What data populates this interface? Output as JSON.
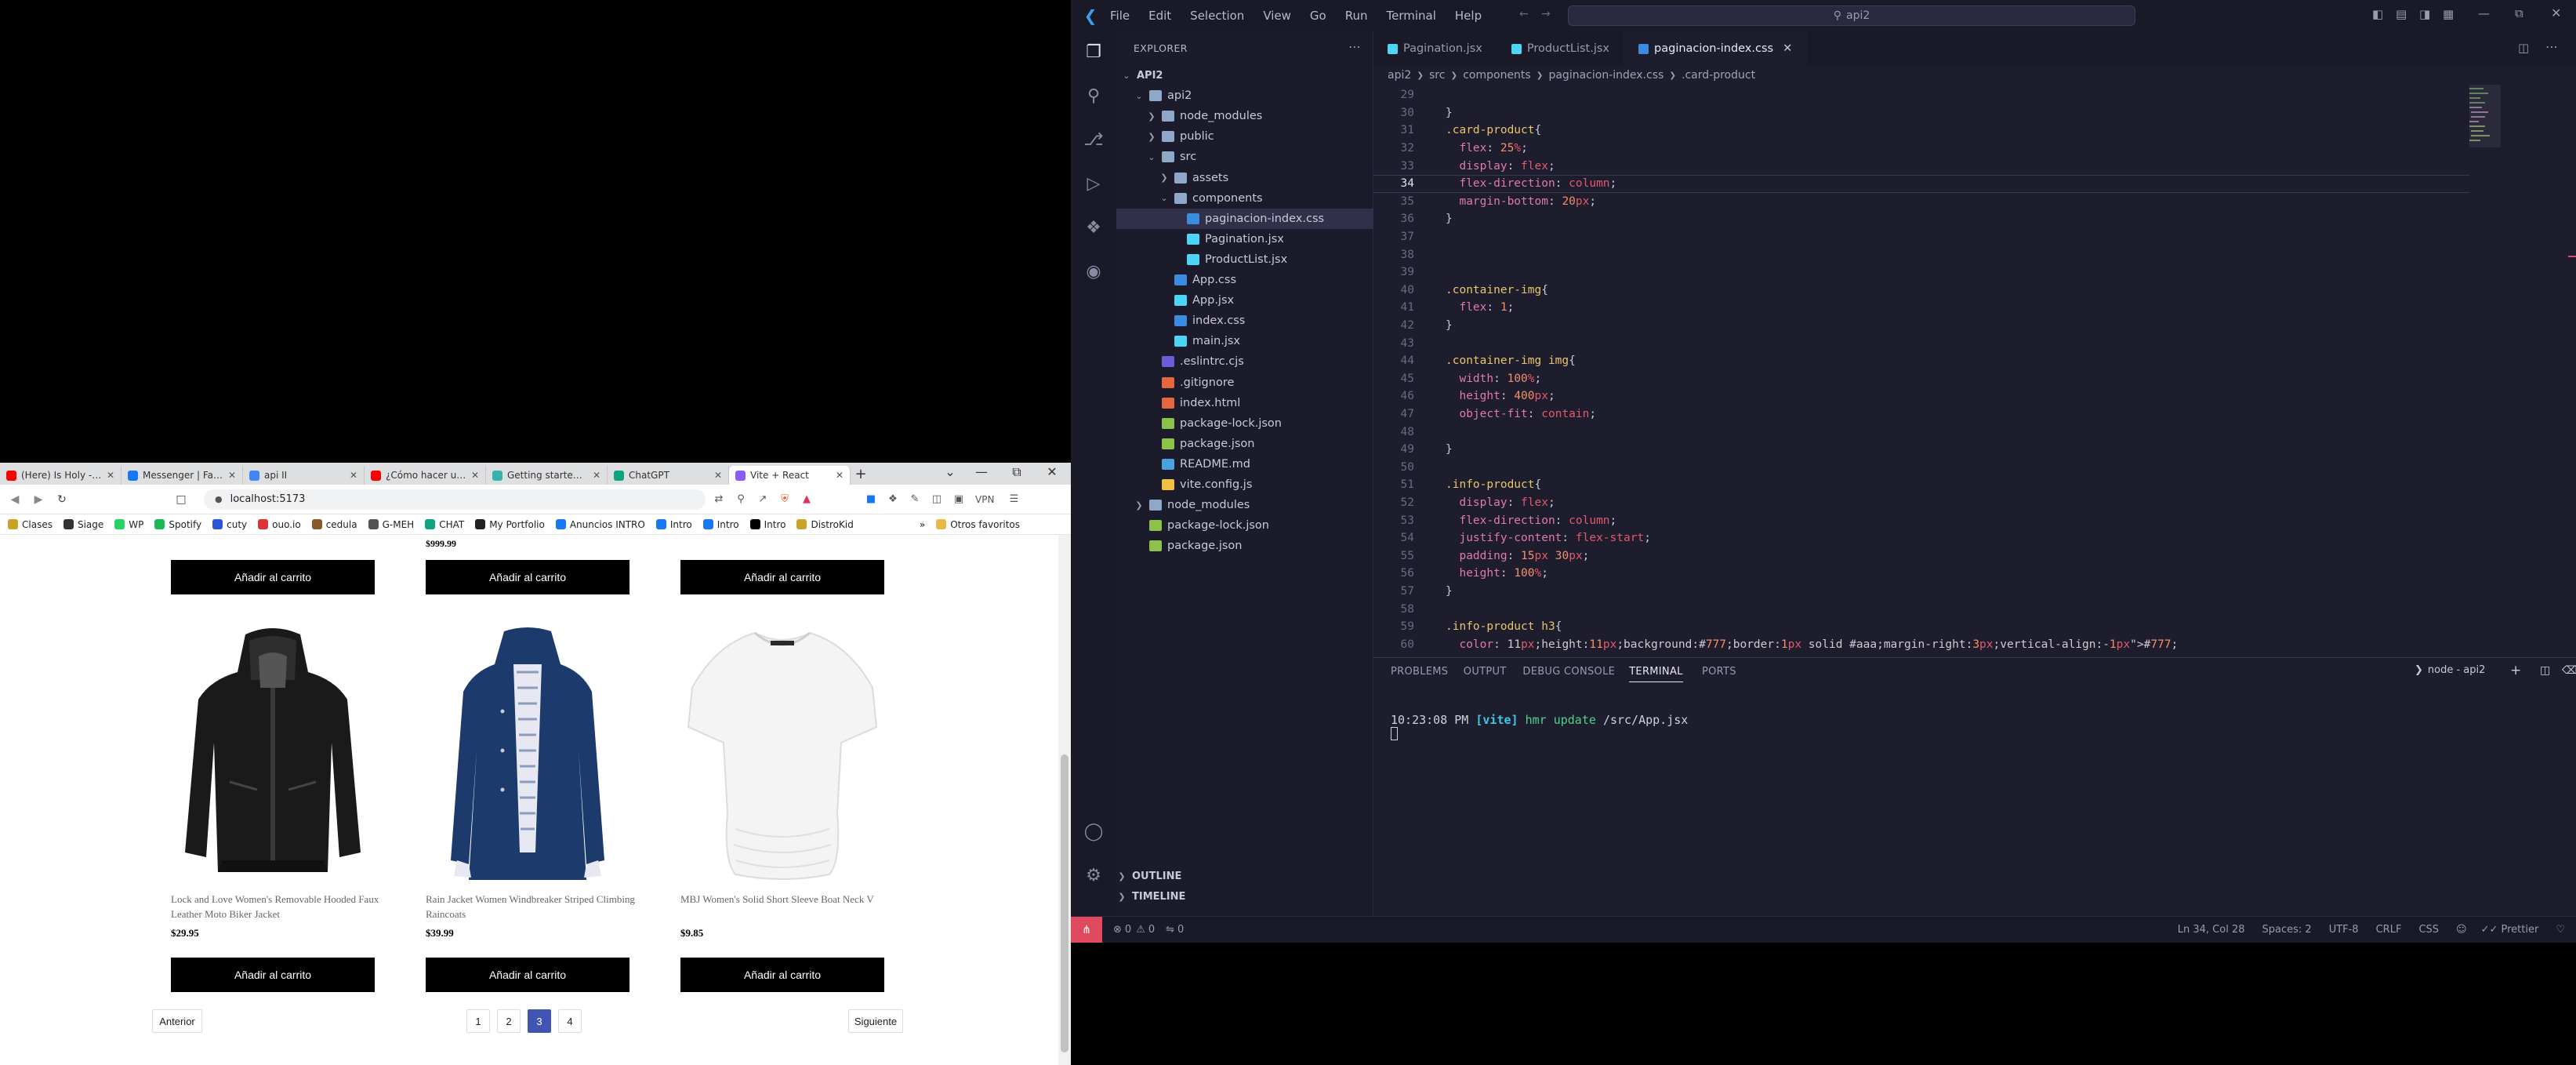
{
  "browser": {
    "tabs": [
      {
        "label": "(Here) Is Holy - Yo",
        "color": "#ff0000"
      },
      {
        "label": "Messenger | Facebook",
        "color": "#1877f2"
      },
      {
        "label": "api II",
        "color": "#4285f4"
      },
      {
        "label": "¿Cómo hacer una pág",
        "color": "#ff0000"
      },
      {
        "label": "Getting started with S",
        "color": "#38b2ac"
      },
      {
        "label": "ChatGPT",
        "color": "#10a37f"
      },
      {
        "label": "Vite + React",
        "color": "#8a5cf6",
        "active": true
      }
    ],
    "new_tab": "+",
    "url": "localhost:5173",
    "vpn": "VPN",
    "bookmarks": [
      {
        "label": "Clases",
        "color": "#c9a227"
      },
      {
        "label": "Siage",
        "color": "#333333"
      },
      {
        "label": "WP",
        "color": "#25d366"
      },
      {
        "label": "Spotify",
        "color": "#1db954"
      },
      {
        "label": "cuty",
        "color": "#2b55d6"
      },
      {
        "label": "ouo.io",
        "color": "#d33"
      },
      {
        "label": "cedula",
        "color": "#8b5a2b"
      },
      {
        "label": "G-MEH",
        "color": "#555"
      },
      {
        "label": "CHAT",
        "color": "#10a37f"
      },
      {
        "label": "My Portfolio",
        "color": "#222"
      },
      {
        "label": "Anuncios INTRO",
        "color": "#1877f2"
      },
      {
        "label": "Intro",
        "color": "#1877f2"
      },
      {
        "label": "Intro",
        "color": "#1877f2"
      },
      {
        "label": "Intro",
        "color": "#000"
      },
      {
        "label": "DistroKid",
        "color": "#c9a227"
      }
    ],
    "bookmarks_more": "»",
    "other_favorites": "Otros favoritos",
    "shop": {
      "top_price": "$999.99",
      "add_to_cart": "Añadir al carrito",
      "products": [
        {
          "name": "Lock and Love Women's Removable Hooded Faux Leather Moto Biker Jacket",
          "price": "$29.95",
          "image": "black-leather-jacket"
        },
        {
          "name": "Rain Jacket Women Windbreaker Striped Climbing Raincoats",
          "price": "$39.99",
          "image": "navy-rain-jacket"
        },
        {
          "name": "MBJ Women's Solid Short Sleeve Boat Neck V",
          "price": "$9.85",
          "image": "white-tshirt"
        }
      ],
      "pagination": {
        "prev": "Anterior",
        "next": "Siguiente",
        "pages": [
          "1",
          "2",
          "3",
          "4"
        ],
        "current": "3"
      }
    }
  },
  "vscode": {
    "menu": [
      "File",
      "Edit",
      "Selection",
      "View",
      "Go",
      "Run",
      "Terminal",
      "Help"
    ],
    "search": "api2",
    "explorer_title": "EXPLORER",
    "tree": [
      {
        "label": "API2",
        "depth": 0,
        "type": "root"
      },
      {
        "label": "api2",
        "depth": 1,
        "type": "folder-open"
      },
      {
        "label": "node_modules",
        "depth": 2,
        "type": "folder"
      },
      {
        "label": "public",
        "depth": 2,
        "type": "folder"
      },
      {
        "label": "src",
        "depth": 2,
        "type": "folder-open"
      },
      {
        "label": "assets",
        "depth": 3,
        "type": "folder"
      },
      {
        "label": "components",
        "depth": 3,
        "type": "folder-open"
      },
      {
        "label": "paginacion-index.css",
        "depth": 4,
        "type": "css",
        "selected": true
      },
      {
        "label": "Pagination.jsx",
        "depth": 4,
        "type": "jsx"
      },
      {
        "label": "ProductList.jsx",
        "depth": 4,
        "type": "jsx"
      },
      {
        "label": "App.css",
        "depth": 3,
        "type": "css"
      },
      {
        "label": "App.jsx",
        "depth": 3,
        "type": "jsx"
      },
      {
        "label": "index.css",
        "depth": 3,
        "type": "css"
      },
      {
        "label": "main.jsx",
        "depth": 3,
        "type": "jsx"
      },
      {
        "label": ".eslintrc.cjs",
        "depth": 2,
        "type": "eslint"
      },
      {
        "label": ".gitignore",
        "depth": 2,
        "type": "git"
      },
      {
        "label": "index.html",
        "depth": 2,
        "type": "html"
      },
      {
        "label": "package-lock.json",
        "depth": 2,
        "type": "json"
      },
      {
        "label": "package.json",
        "depth": 2,
        "type": "json"
      },
      {
        "label": "README.md",
        "depth": 2,
        "type": "md"
      },
      {
        "label": "vite.config.js",
        "depth": 2,
        "type": "vite"
      },
      {
        "label": "node_modules",
        "depth": 1,
        "type": "folder"
      },
      {
        "label": "package-lock.json",
        "depth": 1,
        "type": "json"
      },
      {
        "label": "package.json",
        "depth": 1,
        "type": "json"
      }
    ],
    "outline": "OUTLINE",
    "timeline": "TIMELINE",
    "tabs": [
      {
        "label": "Pagination.jsx",
        "type": "jsx"
      },
      {
        "label": "ProductList.jsx",
        "type": "jsx"
      },
      {
        "label": "paginacion-index.css",
        "type": "css",
        "active": true
      }
    ],
    "breadcrumbs": [
      "api2",
      "src",
      "components",
      "paginacion-index.css",
      ".card-product"
    ],
    "code": [
      {
        "n": "29",
        "t": ""
      },
      {
        "n": "30",
        "t": "}"
      },
      {
        "n": "31",
        "t": ".card-product{"
      },
      {
        "n": "32",
        "t": "  flex: 25%;"
      },
      {
        "n": "33",
        "t": "  display: flex;"
      },
      {
        "n": "34",
        "t": "  flex-direction: column;",
        "cur": true
      },
      {
        "n": "35",
        "t": "  margin-bottom: 20px;"
      },
      {
        "n": "36",
        "t": "}"
      },
      {
        "n": "37",
        "t": ""
      },
      {
        "n": "38",
        "t": ""
      },
      {
        "n": "39",
        "t": ""
      },
      {
        "n": "40",
        "t": ".container-img{"
      },
      {
        "n": "41",
        "t": "  flex: 1;"
      },
      {
        "n": "42",
        "t": "}"
      },
      {
        "n": "43",
        "t": ""
      },
      {
        "n": "44",
        "t": ".container-img img{"
      },
      {
        "n": "45",
        "t": "  width: 100%;"
      },
      {
        "n": "46",
        "t": "  height: 400px;"
      },
      {
        "n": "47",
        "t": "  object-fit: contain;"
      },
      {
        "n": "48",
        "t": ""
      },
      {
        "n": "49",
        "t": "}"
      },
      {
        "n": "50",
        "t": ""
      },
      {
        "n": "51",
        "t": ".info-product{"
      },
      {
        "n": "52",
        "t": "  display: flex;"
      },
      {
        "n": "53",
        "t": "  flex-direction: column;"
      },
      {
        "n": "54",
        "t": "  justify-content: flex-start;"
      },
      {
        "n": "55",
        "t": "  padding: 15px 30px;"
      },
      {
        "n": "56",
        "t": "  height: 100%;"
      },
      {
        "n": "57",
        "t": "}"
      },
      {
        "n": "58",
        "t": ""
      },
      {
        "n": "59",
        "t": ".info-product h3{"
      },
      {
        "n": "60",
        "t": "  color: #777;"
      }
    ],
    "panel_tabs": [
      "PROBLEMS",
      "OUTPUT",
      "DEBUG CONSOLE",
      "TERMINAL",
      "PORTS"
    ],
    "panel_active": "TERMINAL",
    "terminal_name": "node - api2",
    "terminal": {
      "time": "10:23:08 PM",
      "tag": "[vite]",
      "msg": "hmr update",
      "path": "/src/App.jsx"
    },
    "status": {
      "errors": "0",
      "warnings": "0",
      "ports": "0",
      "position": "Ln 34, Col 28",
      "spaces": "Spaces: 2",
      "encoding": "UTF-8",
      "eol": "CRLF",
      "lang": "CSS",
      "formatter": "Prettier"
    }
  }
}
